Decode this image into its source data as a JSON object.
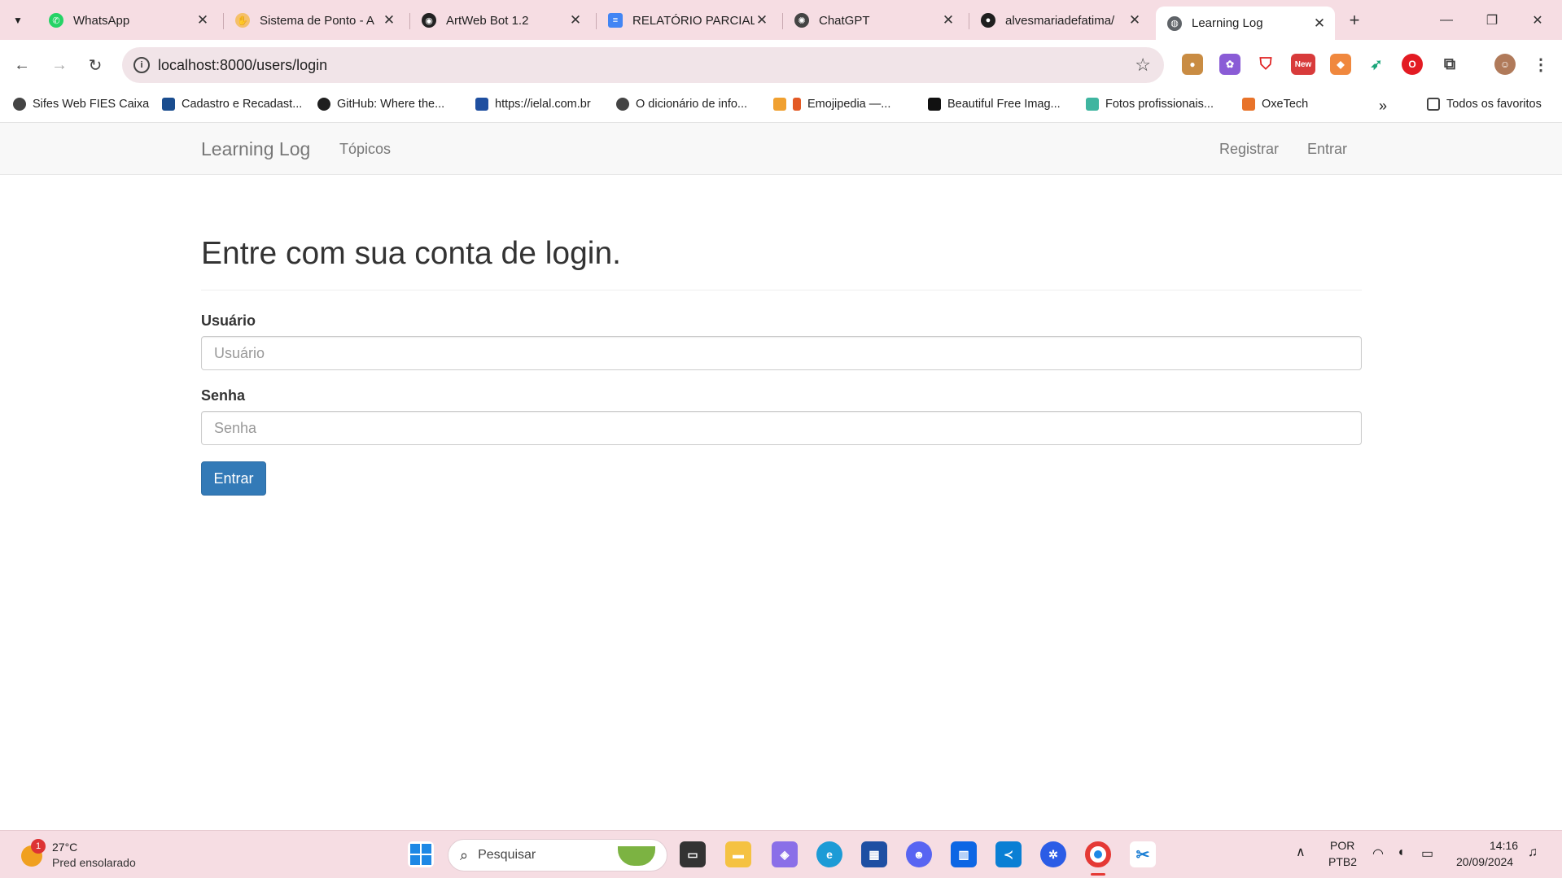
{
  "browser": {
    "tabs": [
      {
        "title": "WhatsApp",
        "icon": "whatsapp-icon",
        "color": "#25d366"
      },
      {
        "title": "Sistema de Ponto - A",
        "icon": "hand-icon",
        "color": "#f5c06a"
      },
      {
        "title": "ArtWeb Bot 1.2",
        "icon": "artweb-icon",
        "color": "#222222"
      },
      {
        "title": "RELATÓRIO PARCIAL",
        "icon": "docs-icon",
        "color": "#4285f4"
      },
      {
        "title": "ChatGPT",
        "icon": "chatgpt-icon",
        "color": "#444444"
      },
      {
        "title": "alvesmariadefatima/",
        "icon": "github-icon",
        "color": "#1f1f1f"
      },
      {
        "title": "Learning Log",
        "icon": "globe-icon",
        "color": "#5f6368"
      }
    ],
    "url": "localhost:8000/users/login",
    "bookmarks": [
      {
        "label": "Sifes Web FIES Caixa",
        "color": "#444444"
      },
      {
        "label": "Cadastro e Recadast...",
        "color": "#1a4d8f"
      },
      {
        "label": "GitHub: Where the...",
        "color": "#1f1f1f"
      },
      {
        "label": "https://ielal.com.br",
        "color": "#1f4fa0"
      },
      {
        "label": "O dicionário de info...",
        "color": "#444444"
      },
      {
        "label": "Emojipedia —...",
        "color": "#e35a25"
      },
      {
        "label": "Beautiful Free Imag...",
        "color": "#111111"
      },
      {
        "label": "Fotos profissionais...",
        "color": "#3fb5a0"
      },
      {
        "label": "OxeTech",
        "color": "#e8732a"
      }
    ],
    "all_bookmarks": "Todos os favoritos",
    "new_badge": "New"
  },
  "app": {
    "brand": "Learning Log",
    "nav_topics": "Tópicos",
    "nav_register": "Registrar",
    "nav_login": "Entrar"
  },
  "login": {
    "heading": "Entre com sua conta de login.",
    "user_label": "Usuário",
    "user_placeholder": "Usuário",
    "pass_label": "Senha",
    "pass_placeholder": "Senha",
    "submit": "Entrar",
    "submit_color": "#337ab7"
  },
  "taskbar": {
    "weather_temp": "27°C",
    "weather_desc": "Pred ensolarado",
    "weather_badge": "1",
    "search_placeholder": "Pesquisar",
    "lang": "POR",
    "layout": "PTB2",
    "time": "14:16",
    "date": "20/09/2024"
  }
}
